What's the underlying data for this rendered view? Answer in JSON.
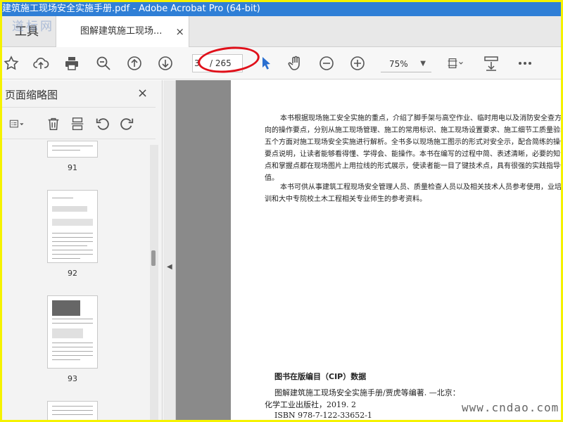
{
  "window": {
    "title": "建筑施工现场安全实施手册.pdf - Adobe Acrobat Pro (64-bit)"
  },
  "watermark_top": "道标网",
  "tabs": {
    "tools_label": "工具",
    "doc_label": "图解建筑施工现场...",
    "close": "×"
  },
  "toolbar": {
    "page_current": "3",
    "page_total": "/ 265",
    "zoom": "75%",
    "icons": [
      "star-icon",
      "cloud-upload-icon",
      "print-icon",
      "zoom-out-search-icon",
      "arrow-up-circle-icon",
      "arrow-down-circle-icon",
      "cursor-icon",
      "hand-icon",
      "minus-circle-icon",
      "plus-circle-icon",
      "page-fit-icon",
      "scroll-icon",
      "more-icon"
    ]
  },
  "sidebar": {
    "title": "页面缩略图",
    "close": "×",
    "thumbnails": [
      {
        "page": "91"
      },
      {
        "page": "92"
      },
      {
        "page": "93"
      }
    ]
  },
  "document": {
    "paragraph1": "本书根据现场施工安全实施的重点，介绍了脚手架与高空作业、临时用电以及消防安全查方向的操作要点，分别从施工现场管理、施工的常用标识、施工现场设置要求、施工细节工质量验收五个方面对施工现场安全实施进行解析。全书多以现场施工图示的形式对安全示，配合简练的操作要点说明，让读者能够看得懂、学得会、能操作。本书在编写的过程中简、表述清晰，必要的知识点和掌握点都在现场图片上用拉线的形式展示，使读者能一目了键技术点，具有很强的实践指导价值。",
    "paragraph2": "本书可供从事建筑工程现场安全管理人员、质量检查人员以及相关技术人员参考使用，业培训和大中专院校土木工程相关专业师生的参考资料。",
    "cip_title": "图书在版编目（CIP）数据",
    "cip_line1": "图解建筑施工现场安全实施手册/贾虎等编著. —北京：",
    "cip_line2": "化学工业出版社，2019. 2",
    "cip_line3": "ISBN 978-7-122-33652-1"
  },
  "site_watermark": "www.cndao.com",
  "colors": {
    "titlebar": "#2f7fd6",
    "frame": "#f5f200",
    "annotation": "#e0101a"
  }
}
